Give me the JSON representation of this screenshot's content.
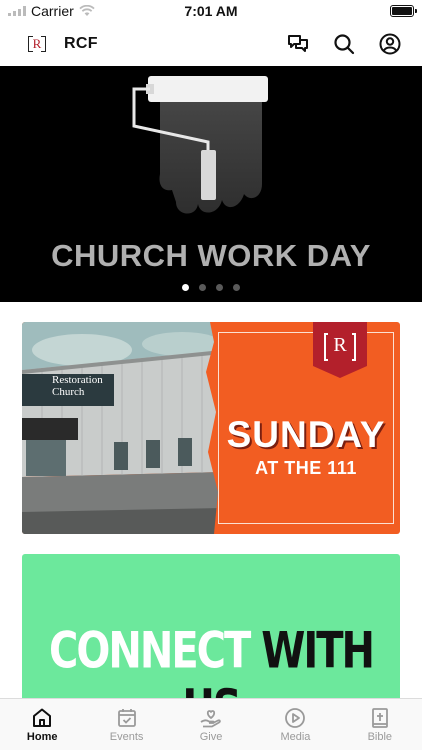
{
  "status_bar": {
    "carrier": "Carrier",
    "time": "7:01 AM"
  },
  "header": {
    "logo_text": "R",
    "title": "RCF"
  },
  "hero": {
    "title": "CHURCH WORK DAY",
    "slide_count": 4,
    "active_slide": 1
  },
  "card_sunday": {
    "sign_line1": "Restoration",
    "sign_line2": "Church",
    "badge_text": "R",
    "headline": "SUNDAY",
    "subline": "AT THE 111"
  },
  "card_connect": {
    "word1": "CONNECT",
    "word2": "WITH US"
  },
  "tabs": [
    {
      "label": "Home",
      "icon": "home-icon",
      "active": true
    },
    {
      "label": "Events",
      "icon": "calendar-icon",
      "active": false
    },
    {
      "label": "Give",
      "icon": "give-icon",
      "active": false
    },
    {
      "label": "Media",
      "icon": "play-icon",
      "active": false
    },
    {
      "label": "Bible",
      "icon": "bible-icon",
      "active": false
    }
  ],
  "colors": {
    "hero_bg": "#000000",
    "sunday_orange": "#f25d22",
    "connect_green": "#6ce89c",
    "logo_red": "#b3202b"
  }
}
